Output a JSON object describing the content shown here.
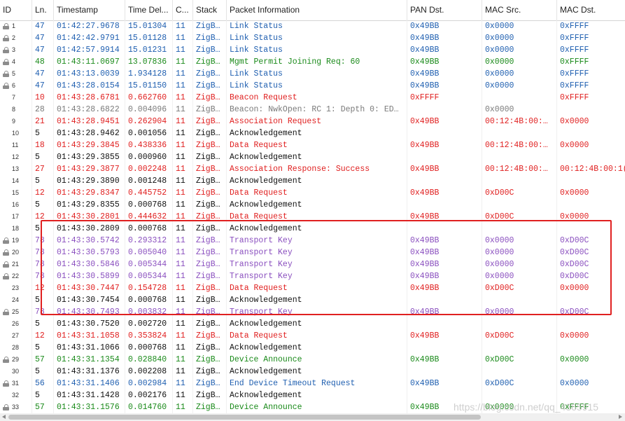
{
  "columns": [
    "ID",
    "Ln.",
    "Timestamp",
    "Time Del...",
    "C...",
    "Stack",
    "Packet Information",
    "PAN Dst.",
    "MAC Src.",
    "MAC Dst."
  ],
  "colors": {
    "blue": "#1f5fb0",
    "green": "#1a8a1a",
    "red": "#e02020",
    "black": "#111111",
    "gray": "#7a7a7a",
    "purple": "#8a4fbf",
    "highlight_border": "#e02020"
  },
  "rows": [
    {
      "id": "1",
      "lock": true,
      "color": "blue",
      "ln": "47",
      "ts": "01:42:27.9678",
      "td": "15.01304",
      "c": "11",
      "stack": "ZigB…",
      "info": "Link Status",
      "pan": "0x49BB",
      "src": "0x0000",
      "dst": "0xFFFF"
    },
    {
      "id": "2",
      "lock": true,
      "color": "blue",
      "ln": "47",
      "ts": "01:42:42.9791",
      "td": "15.01128",
      "c": "11",
      "stack": "ZigB…",
      "info": "Link Status",
      "pan": "0x49BB",
      "src": "0x0000",
      "dst": "0xFFFF"
    },
    {
      "id": "3",
      "lock": true,
      "color": "blue",
      "ln": "47",
      "ts": "01:42:57.9914",
      "td": "15.01231",
      "c": "11",
      "stack": "ZigB…",
      "info": "Link Status",
      "pan": "0x49BB",
      "src": "0x0000",
      "dst": "0xFFFF"
    },
    {
      "id": "4",
      "lock": true,
      "color": "green",
      "ln": "48",
      "ts": "01:43:11.0697",
      "td": "13.07836",
      "c": "11",
      "stack": "ZigB…",
      "info": "Mgmt Permit Joining Req: 60",
      "pan": "0x49BB",
      "src": "0x0000",
      "dst": "0xFFFF"
    },
    {
      "id": "5",
      "lock": true,
      "color": "blue",
      "ln": "47",
      "ts": "01:43:13.0039",
      "td": "1.934128",
      "c": "11",
      "stack": "ZigB…",
      "info": "Link Status",
      "pan": "0x49BB",
      "src": "0x0000",
      "dst": "0xFFFF"
    },
    {
      "id": "6",
      "lock": true,
      "color": "blue",
      "ln": "47",
      "ts": "01:43:28.0154",
      "td": "15.01150",
      "c": "11",
      "stack": "ZigB…",
      "info": "Link Status",
      "pan": "0x49BB",
      "src": "0x0000",
      "dst": "0xFFFF"
    },
    {
      "id": "7",
      "lock": false,
      "color": "red",
      "ln": "10",
      "ts": "01:43:28.6781",
      "td": "0.662760",
      "c": "11",
      "stack": "ZigB…",
      "info": "Beacon Request",
      "pan": "0xFFFF",
      "src": "",
      "dst": "0xFFFF"
    },
    {
      "id": "8",
      "lock": false,
      "color": "gray",
      "ln": "28",
      "ts": "01:43:28.6822",
      "td": "0.004096",
      "c": "11",
      "stack": "ZigB…",
      "info": "Beacon: NwkOpen: RC 1: Depth 0: ED…",
      "pan": "",
      "src": "0x0000",
      "dst": ""
    },
    {
      "id": "9",
      "lock": false,
      "color": "red",
      "ln": "21",
      "ts": "01:43:28.9451",
      "td": "0.262904",
      "c": "11",
      "stack": "ZigB…",
      "info": "Association Request",
      "pan": "0x49BB",
      "src": "00:12:4B:00:…",
      "dst": "0x0000"
    },
    {
      "id": "10",
      "lock": false,
      "color": "black",
      "ln": "5",
      "ts": "01:43:28.9462",
      "td": "0.001056",
      "c": "11",
      "stack": "ZigB…",
      "info": "Acknowledgement",
      "pan": "",
      "src": "",
      "dst": ""
    },
    {
      "id": "11",
      "lock": false,
      "color": "red",
      "ln": "18",
      "ts": "01:43:29.3845",
      "td": "0.438336",
      "c": "11",
      "stack": "ZigB…",
      "info": "Data Request",
      "pan": "0x49BB",
      "src": "00:12:4B:00:…",
      "dst": "0x0000"
    },
    {
      "id": "12",
      "lock": false,
      "color": "black",
      "ln": "5",
      "ts": "01:43:29.3855",
      "td": "0.000960",
      "c": "11",
      "stack": "ZigB…",
      "info": "Acknowledgement",
      "pan": "",
      "src": "",
      "dst": ""
    },
    {
      "id": "13",
      "lock": false,
      "color": "red",
      "ln": "27",
      "ts": "01:43:29.3877",
      "td": "0.002248",
      "c": "11",
      "stack": "ZigB…",
      "info": "Association Response: Success",
      "pan": "0x49BB",
      "src": "00:12:4B:00:…",
      "dst": "00:12:4B:00:1("
    },
    {
      "id": "14",
      "lock": false,
      "color": "black",
      "ln": "5",
      "ts": "01:43:29.3890",
      "td": "0.001248",
      "c": "11",
      "stack": "ZigB…",
      "info": "Acknowledgement",
      "pan": "",
      "src": "",
      "dst": ""
    },
    {
      "id": "15",
      "lock": false,
      "color": "red",
      "ln": "12",
      "ts": "01:43:29.8347",
      "td": "0.445752",
      "c": "11",
      "stack": "ZigB…",
      "info": "Data Request",
      "pan": "0x49BB",
      "src": "0xD00C",
      "dst": "0x0000"
    },
    {
      "id": "16",
      "lock": false,
      "color": "black",
      "ln": "5",
      "ts": "01:43:29.8355",
      "td": "0.000768",
      "c": "11",
      "stack": "ZigB…",
      "info": "Acknowledgement",
      "pan": "",
      "src": "",
      "dst": ""
    },
    {
      "id": "17",
      "lock": false,
      "color": "red",
      "ln": "12",
      "ts": "01:43:30.2801",
      "td": "0.444632",
      "c": "11",
      "stack": "ZigB…",
      "info": "Data Request",
      "pan": "0x49BB",
      "src": "0xD00C",
      "dst": "0x0000"
    },
    {
      "id": "18",
      "lock": false,
      "color": "black",
      "ln": "5",
      "ts": "01:43:30.2809",
      "td": "0.000768",
      "c": "11",
      "stack": "ZigB…",
      "info": "Acknowledgement",
      "pan": "",
      "src": "",
      "dst": ""
    },
    {
      "id": "19",
      "lock": true,
      "color": "purple",
      "ln": "78",
      "ts": "01:43:30.5742",
      "td": "0.293312",
      "c": "11",
      "stack": "ZigB…",
      "info": "Transport Key",
      "pan": "0x49BB",
      "src": "0x0000",
      "dst": "0xD00C"
    },
    {
      "id": "20",
      "lock": true,
      "color": "purple",
      "ln": "78",
      "ts": "01:43:30.5793",
      "td": "0.005040",
      "c": "11",
      "stack": "ZigB…",
      "info": "Transport Key",
      "pan": "0x49BB",
      "src": "0x0000",
      "dst": "0xD00C"
    },
    {
      "id": "21",
      "lock": true,
      "color": "purple",
      "ln": "78",
      "ts": "01:43:30.5846",
      "td": "0.005344",
      "c": "11",
      "stack": "ZigB…",
      "info": "Transport Key",
      "pan": "0x49BB",
      "src": "0x0000",
      "dst": "0xD00C"
    },
    {
      "id": "22",
      "lock": true,
      "color": "purple",
      "ln": "78",
      "ts": "01:43:30.5899",
      "td": "0.005344",
      "c": "11",
      "stack": "ZigB…",
      "info": "Transport Key",
      "pan": "0x49BB",
      "src": "0x0000",
      "dst": "0xD00C"
    },
    {
      "id": "23",
      "lock": false,
      "color": "red",
      "ln": "12",
      "ts": "01:43:30.7447",
      "td": "0.154728",
      "c": "11",
      "stack": "ZigB…",
      "info": "Data Request",
      "pan": "0x49BB",
      "src": "0xD00C",
      "dst": "0x0000"
    },
    {
      "id": "24",
      "lock": false,
      "color": "black",
      "ln": "5",
      "ts": "01:43:30.7454",
      "td": "0.000768",
      "c": "11",
      "stack": "ZigB…",
      "info": "Acknowledgement",
      "pan": "",
      "src": "",
      "dst": ""
    },
    {
      "id": "25",
      "lock": true,
      "color": "purple",
      "ln": "78",
      "ts": "01:43:30.7493",
      "td": "0.003832",
      "c": "11",
      "stack": "ZigB…",
      "info": "Transport Key",
      "pan": "0x49BB",
      "src": "0x0000",
      "dst": "0xD00C"
    },
    {
      "id": "26",
      "lock": false,
      "color": "black",
      "ln": "5",
      "ts": "01:43:30.7520",
      "td": "0.002720",
      "c": "11",
      "stack": "ZigB…",
      "info": "Acknowledgement",
      "pan": "",
      "src": "",
      "dst": ""
    },
    {
      "id": "27",
      "lock": false,
      "color": "red",
      "ln": "12",
      "ts": "01:43:31.1058",
      "td": "0.353824",
      "c": "11",
      "stack": "ZigB…",
      "info": "Data Request",
      "pan": "0x49BB",
      "src": "0xD00C",
      "dst": "0x0000"
    },
    {
      "id": "28",
      "lock": false,
      "color": "black",
      "ln": "5",
      "ts": "01:43:31.1066",
      "td": "0.000768",
      "c": "11",
      "stack": "ZigB…",
      "info": "Acknowledgement",
      "pan": "",
      "src": "",
      "dst": ""
    },
    {
      "id": "29",
      "lock": true,
      "color": "green",
      "ln": "57",
      "ts": "01:43:31.1354",
      "td": "0.028840",
      "c": "11",
      "stack": "ZigB…",
      "info": "Device Announce",
      "pan": "0x49BB",
      "src": "0xD00C",
      "dst": "0x0000"
    },
    {
      "id": "30",
      "lock": false,
      "color": "black",
      "ln": "5",
      "ts": "01:43:31.1376",
      "td": "0.002208",
      "c": "11",
      "stack": "ZigB…",
      "info": "Acknowledgement",
      "pan": "",
      "src": "",
      "dst": ""
    },
    {
      "id": "31",
      "lock": true,
      "color": "blue",
      "ln": "56",
      "ts": "01:43:31.1406",
      "td": "0.002984",
      "c": "11",
      "stack": "ZigB…",
      "info": "End Device Timeout Request",
      "pan": "0x49BB",
      "src": "0xD00C",
      "dst": "0x0000"
    },
    {
      "id": "32",
      "lock": false,
      "color": "black",
      "ln": "5",
      "ts": "01:43:31.1428",
      "td": "0.002176",
      "c": "11",
      "stack": "ZigB…",
      "info": "Acknowledgement",
      "pan": "",
      "src": "",
      "dst": ""
    },
    {
      "id": "33",
      "lock": true,
      "color": "green",
      "ln": "57",
      "ts": "01:43:31.1576",
      "td": "0.014760",
      "c": "11",
      "stack": "ZigB…",
      "info": "Device Announce",
      "pan": "0x49BB",
      "src": "0x0000",
      "dst": "0xFFFF"
    }
  ],
  "watermark": "https://blog.csdn.net/qq_4365915"
}
